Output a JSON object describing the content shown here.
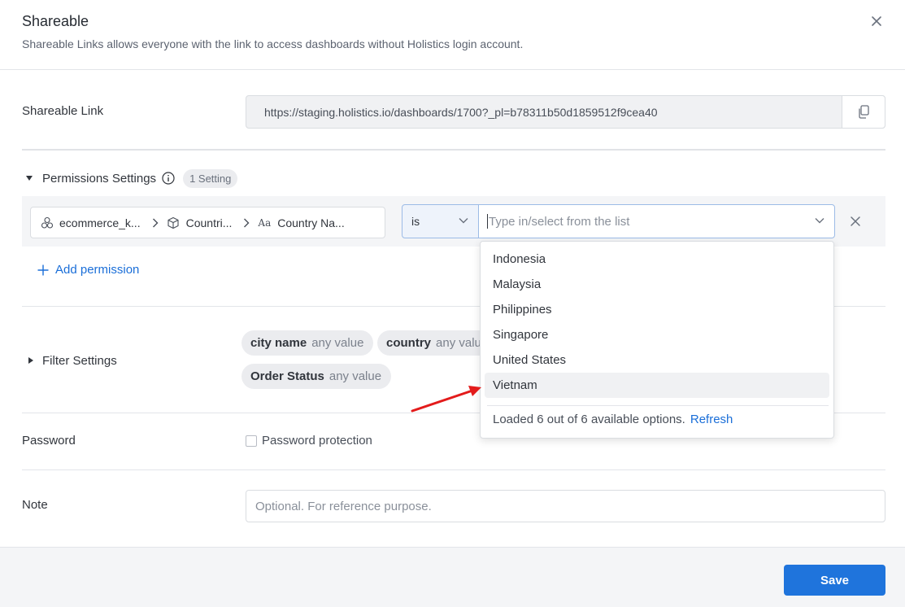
{
  "header": {
    "title": "Shareable",
    "subtitle": "Shareable Links allows everyone with the link to access dashboards without Holistics login account."
  },
  "shareable_link": {
    "label": "Shareable Link",
    "url": "https://staging.holistics.io/dashboards/1700?_pl=b78311b50d1859512f9cea40"
  },
  "permissions": {
    "title": "Permissions Settings",
    "badge": "1 Setting",
    "row": {
      "path": [
        "ecommerce_k...",
        "Countri...",
        "Country Na..."
      ],
      "operator": "is",
      "value_placeholder": "Type in/select from the list"
    },
    "add_label": "Add permission"
  },
  "filter": {
    "title": "Filter Settings",
    "chips": [
      {
        "name": "city name",
        "value": "any value"
      },
      {
        "name": "country",
        "value": "any valu"
      },
      {
        "name": "Order Status",
        "value": "any value"
      }
    ]
  },
  "password": {
    "label": "Password",
    "checkbox_label": "Password protection",
    "checked": false
  },
  "note": {
    "label": "Note",
    "placeholder": "Optional. For reference purpose.",
    "value": ""
  },
  "footer": {
    "save_label": "Save"
  },
  "dropdown": {
    "options": [
      "Indonesia",
      "Malaysia",
      "Philippines",
      "Singapore",
      "United States",
      "Vietnam"
    ],
    "highlighted": "Vietnam",
    "status_text": "Loaded 6 out of 6 available options.",
    "refresh_label": "Refresh"
  },
  "colors": {
    "accent": "#1f74dc",
    "link": "#1a6ed8",
    "annotation_arrow": "#e31b1b"
  }
}
